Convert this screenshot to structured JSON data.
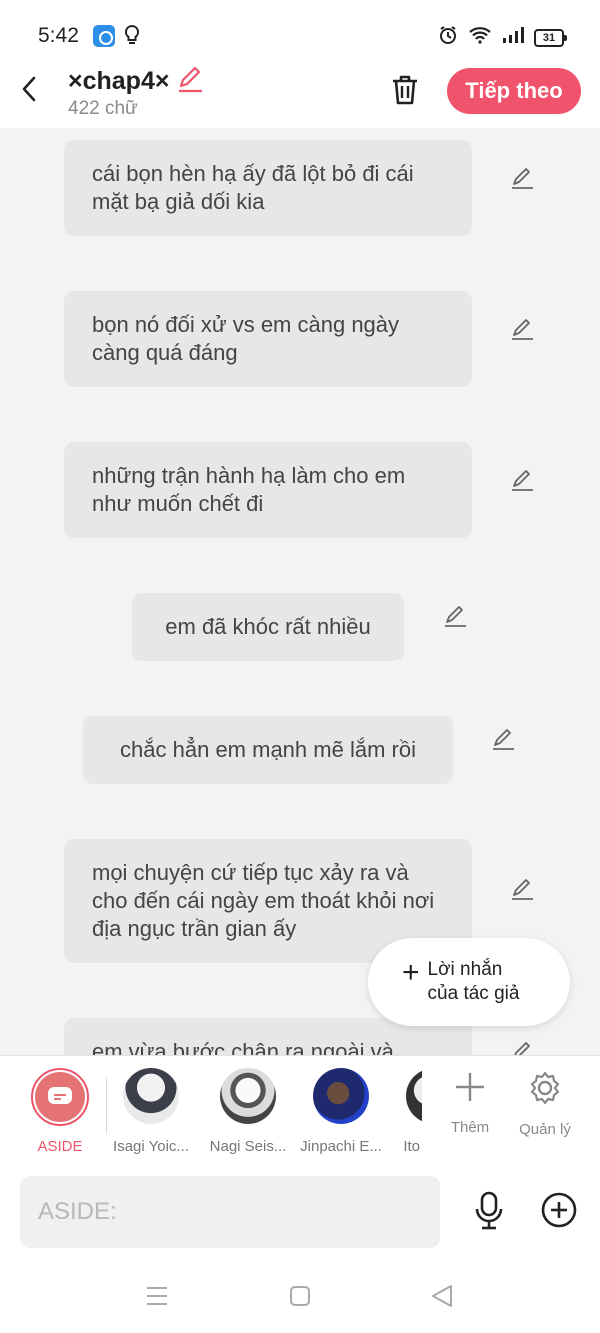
{
  "status_bar": {
    "time": "5:42",
    "battery": "31",
    "icons": [
      "cloud-app-icon",
      "bulb-icon",
      "alarm-icon",
      "wifi-icon",
      "signal-icon",
      "battery-icon"
    ]
  },
  "header": {
    "title": "×chap4×",
    "word_count": "422 chữ",
    "next_label": "Tiếp theo",
    "accent_color": "#f0546c"
  },
  "messages": [
    {
      "text": "cái bọn hèn hạ ấy đã lột bỏ đi cái mặt bạ giả dối kia"
    },
    {
      "text": "bọn nó đối xử vs em càng ngày càng quá đáng"
    },
    {
      "text": "những trận hành hạ làm cho em như muốn chết đi"
    },
    {
      "text": "em đã khóc rất nhiều"
    },
    {
      "text": "chắc hẳn em mạnh mẽ lắm rồi"
    },
    {
      "text": "mọi chuyện cứ tiếp tục xảy ra và cho đến cái ngày em thoát khỏi nơi địa ngục trần gian ấy"
    },
    {
      "text": "em vừa bước chân ra ngoài và"
    }
  ],
  "author_note": {
    "label": "Lời nhắn của tác giả"
  },
  "characters": {
    "aside": "ASIDE",
    "items": [
      {
        "name": "Isagi Yoic..."
      },
      {
        "name": "Nagi Seis..."
      },
      {
        "name": "Jinpachi E..."
      },
      {
        "name": "Ito"
      }
    ],
    "add_label": "Thêm",
    "manage_label": "Quản lý"
  },
  "input": {
    "placeholder": "ASIDE:"
  }
}
